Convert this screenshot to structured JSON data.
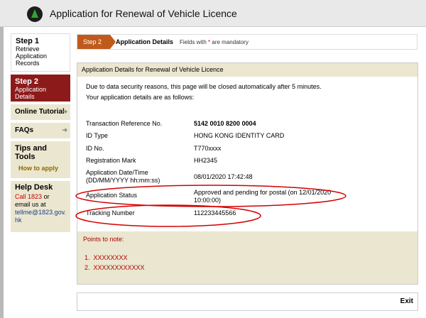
{
  "header": {
    "title": "Application for Renewal of Vehicle Licence",
    "logo_icon": "hk-government-logo"
  },
  "sidebar": {
    "step1": {
      "label": "Step 1",
      "text": "Retrieve Application Records"
    },
    "step2": {
      "label": "Step 2",
      "text": "Application Details"
    },
    "online_tutorial": "Online Tutorial",
    "faqs": "FAQs",
    "tips": {
      "title": "Tips and Tools",
      "link": "How to apply"
    },
    "help": {
      "title": "Help Desk",
      "call_prefix": "Call",
      "phone": "1823",
      "or_text": "or",
      "email_prefix": "email us at",
      "email": "tellme@1823.gov.hk"
    }
  },
  "stepbar": {
    "badge": "Step 2",
    "name": "Application Details",
    "note_prefix": "Fields with",
    "note_star": "*",
    "note_suffix": "are mandatory"
  },
  "panel": {
    "heading": "Application Details for Renewal of Vehicle Licence",
    "security_note": "Due to data security reasons, this page will be closed automatically after 5 minutes.",
    "intro": "Your application details are as follows:",
    "details": [
      {
        "label": "Transaction Reference No.",
        "value": "5142 0010 8200 0004",
        "bold": true
      },
      {
        "label": "ID Type",
        "value": "HONG KONG IDENTITY CARD"
      },
      {
        "label": "ID No.",
        "value": "T770xxxx"
      },
      {
        "label": "Registration Mark",
        "value": "HH2345"
      },
      {
        "label": "Application Date/Time (DD/MM/YYYY hh:mm:ss)",
        "value": "08/01/2020 17:42:48"
      },
      {
        "label": "Application Status",
        "value": "Approved and pending for postal (on 12/01/2020 10:00:00)"
      },
      {
        "label": "Tracking Number",
        "value": "112233445566"
      }
    ],
    "points_title": "Points to note:",
    "points": [
      "XXXXXXXX",
      "XXXXXXXXXXXX"
    ]
  },
  "footer": {
    "exit_label": "Exit"
  },
  "colors": {
    "accent_red": "#8d1a1a",
    "step_orange": "#c05a1c",
    "beige": "#ebe6cf",
    "annotation": "#d40000"
  }
}
